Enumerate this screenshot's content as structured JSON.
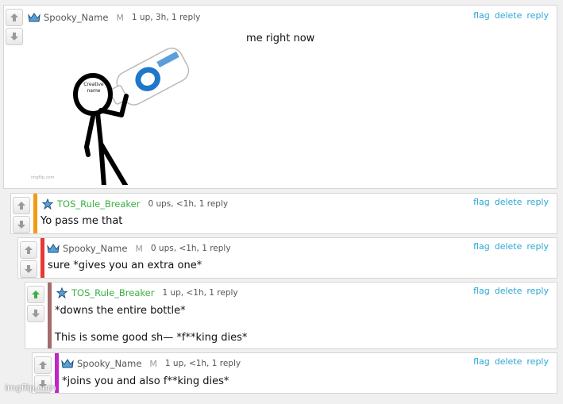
{
  "actions": {
    "flag": "flag",
    "delete": "delete",
    "reply": "reply"
  },
  "comments": [
    {
      "username": "Spooky_Name",
      "badge": "M",
      "meta": "1 up, 3h, 1 reply",
      "image_caption": "me right now",
      "image_label": "Creative name",
      "image_watermark": "imgflip.com",
      "username_color": "#555555",
      "bar_color": "",
      "upvoted": false
    },
    {
      "username": "TOS_Rule_Breaker",
      "badge": "",
      "meta": "0 ups, <1h, 1 reply",
      "text": "Yo pass me that",
      "username_color": "#3cb043",
      "bar_color": "#f39c12",
      "upvoted": false
    },
    {
      "username": "Spooky_Name",
      "badge": "M",
      "meta": "0 ups, <1h, 1 reply",
      "text": "sure *gives you an extra one*",
      "username_color": "#555555",
      "bar_color": "#e53935",
      "upvoted": false
    },
    {
      "username": "TOS_Rule_Breaker",
      "badge": "",
      "meta": "1 up, <1h, 1 reply",
      "text_line1": "*downs the entire bottle*",
      "text_line2": "This is some good sh— *f**king dies*",
      "username_color": "#3cb043",
      "bar_color": "#a66b6b",
      "upvoted": true
    },
    {
      "username": "Spooky_Name",
      "badge": "M",
      "meta": "1 up, <1h, 1 reply",
      "text": "*joins you and also f**king dies*",
      "username_color": "#555555",
      "bar_color": "#c026c7",
      "upvoted": false
    }
  ],
  "footer": {
    "watermark": "imgflip.com"
  },
  "colors": {
    "link": "#2aa8d6",
    "upvote_active": "#3cb043",
    "vote_arrow": "#9a9a9a"
  }
}
